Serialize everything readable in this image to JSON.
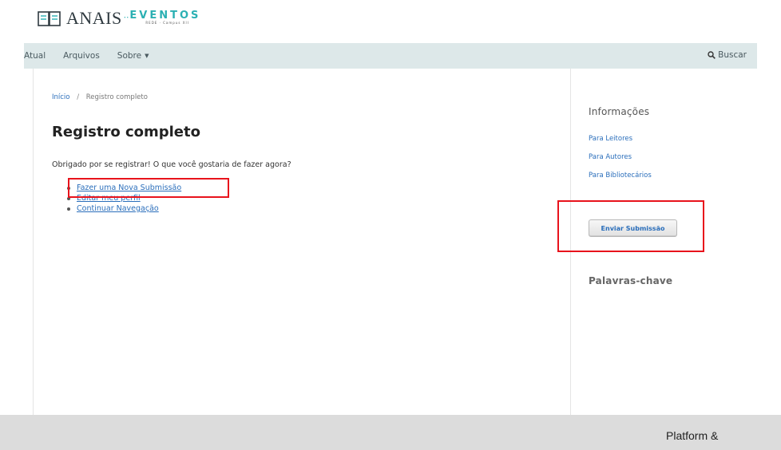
{
  "header": {
    "logo_main": "ANAIS",
    "logo_separator": "∙∙",
    "logo_eventos": "EVENTOS",
    "logo_sub": "REDE · Campus XII"
  },
  "nav": {
    "items": [
      {
        "label": "Atual"
      },
      {
        "label": "Arquivos"
      },
      {
        "label": "Sobre",
        "caret": "▼"
      }
    ],
    "search_label": "Buscar"
  },
  "main": {
    "breadcrumb": {
      "home": "Início",
      "separator": "/",
      "current": "Registro completo"
    },
    "title": "Registro completo",
    "intro": "Obrigado por se registrar! O que você gostaria de fazer agora?",
    "actions": [
      {
        "label": "Fazer uma Nova Submissão"
      },
      {
        "label": "Editar meu perfil"
      },
      {
        "label": "Continuar Navegação"
      }
    ]
  },
  "sidebar": {
    "info_title": "Informações",
    "info_links": [
      {
        "label": "Para Leitores"
      },
      {
        "label": "Para Autores"
      },
      {
        "label": "Para Bibliotecários"
      }
    ],
    "submit_button": "Enviar Submissão",
    "keywords_title": "Palavras-chave"
  },
  "footer": {
    "text": "Platform &"
  },
  "colors": {
    "accent": "#2bb0b3",
    "link": "#2a6ebb",
    "nav_bg": "#dde8e9",
    "highlight": "#e8131c",
    "footer_bg": "#dcdcdc"
  }
}
